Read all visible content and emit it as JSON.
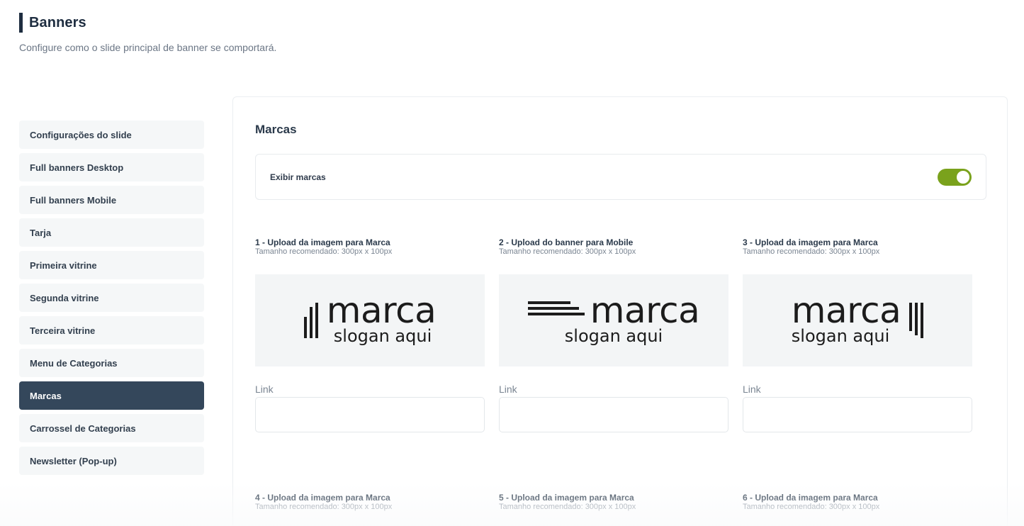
{
  "header": {
    "title": "Banners",
    "subtitle": "Configure como o slide principal de banner se comportará."
  },
  "sidebar": {
    "items": [
      {
        "label": "Configurações do slide"
      },
      {
        "label": "Full banners Desktop"
      },
      {
        "label": "Full banners Mobile"
      },
      {
        "label": "Tarja"
      },
      {
        "label": "Primeira vitrine"
      },
      {
        "label": "Segunda vitrine"
      },
      {
        "label": "Terceira vitrine"
      },
      {
        "label": "Menu de Categorias"
      },
      {
        "label": "Marcas"
      },
      {
        "label": "Carrossel de Categorias"
      },
      {
        "label": "Newsletter (Pop-up)"
      }
    ],
    "active": "Marcas"
  },
  "panel": {
    "title": "Marcas",
    "toggle": {
      "label": "Exibir marcas",
      "on": true,
      "color": "#7aa21c"
    },
    "slots": [
      {
        "title": "1 - Upload da imagem para Marca",
        "hint": "Tamanho recomendado: 300px x 100px",
        "brand": "marca",
        "slogan": "slogan aqui",
        "link_label": "Link",
        "link_value": ""
      },
      {
        "title": "2 - Upload do banner para Mobile",
        "hint": "Tamanho recomendado: 300px x 100px",
        "brand": "marca",
        "slogan": "slogan aqui",
        "link_label": "Link",
        "link_value": ""
      },
      {
        "title": "3 - Upload da imagem para Marca",
        "hint": "Tamanho recomendado: 300px x 100px",
        "brand": "marca",
        "slogan": "slogan aqui",
        "link_label": "Link",
        "link_value": ""
      },
      {
        "title": "4 - Upload da imagem para Marca",
        "hint": "Tamanho recomendado: 300px x 100px"
      },
      {
        "title": "5 - Upload da imagem para Marca",
        "hint": "Tamanho recomendado: 300px x 100px"
      },
      {
        "title": "6 - Upload da imagem para Marca",
        "hint": "Tamanho recomendado: 300px x 100px"
      }
    ]
  },
  "colors": {
    "accent": "#34475b",
    "toggle_on": "#7aa21c"
  }
}
